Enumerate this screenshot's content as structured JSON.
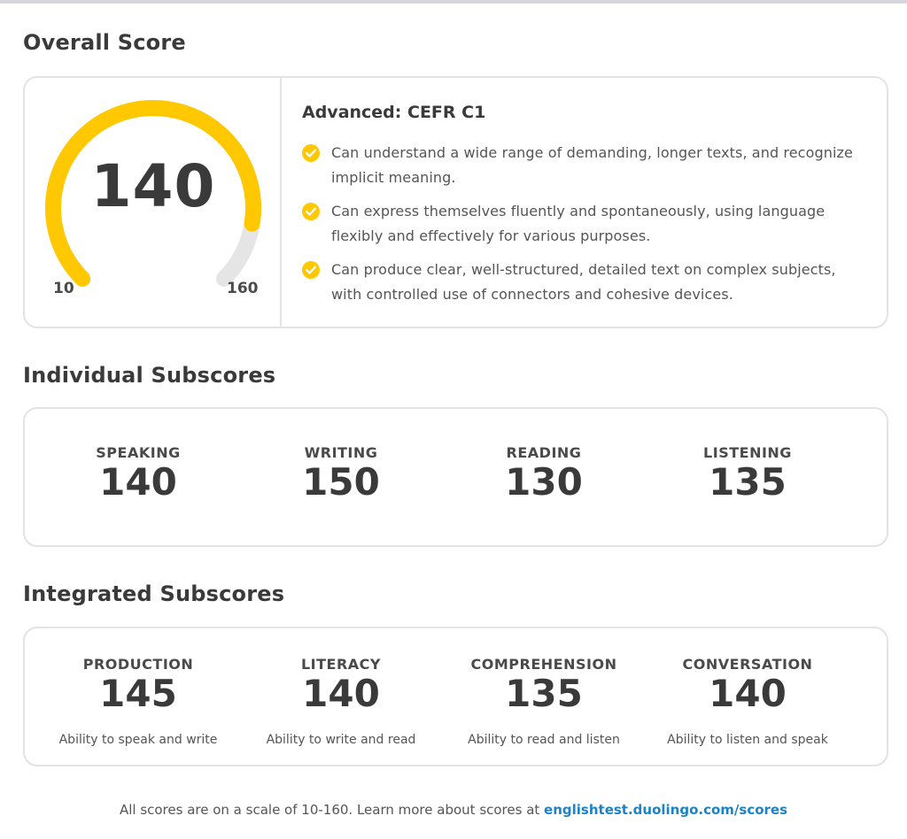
{
  "overall": {
    "title": "Overall Score",
    "score": "140",
    "min_label": "10",
    "max_label": "160",
    "score_value": 140,
    "scale_min": 10,
    "scale_max": 160,
    "level": "Advanced: CEFR C1",
    "descriptions": [
      "Can understand a wide range of demanding, longer texts, and recognize implicit meaning.",
      "Can express themselves fluently and spontaneously, using language flexibly and effectively for various purposes.",
      "Can produce clear, well-structured, detailed text on complex subjects, with controlled use of connectors and cohesive devices."
    ],
    "colors": {
      "gauge_fill": "#ffc800",
      "gauge_track": "#e5e5e5"
    }
  },
  "individual": {
    "title": "Individual Subscores",
    "items": [
      {
        "label": "SPEAKING",
        "value": "140"
      },
      {
        "label": "WRITING",
        "value": "150"
      },
      {
        "label": "READING",
        "value": "130"
      },
      {
        "label": "LISTENING",
        "value": "135"
      }
    ]
  },
  "integrated": {
    "title": "Integrated Subscores",
    "items": [
      {
        "label": "PRODUCTION",
        "value": "145",
        "desc": "Ability to speak and write"
      },
      {
        "label": "LITERACY",
        "value": "140",
        "desc": "Ability to write and read"
      },
      {
        "label": "COMPREHENSION",
        "value": "135",
        "desc": "Ability to read and listen"
      },
      {
        "label": "CONVERSATION",
        "value": "140",
        "desc": "Ability to listen and speak"
      }
    ]
  },
  "footer": {
    "text": "All scores are on a scale of 10-160. Learn more about scores at ",
    "link_text": "englishtest.duolingo.com/scores"
  }
}
